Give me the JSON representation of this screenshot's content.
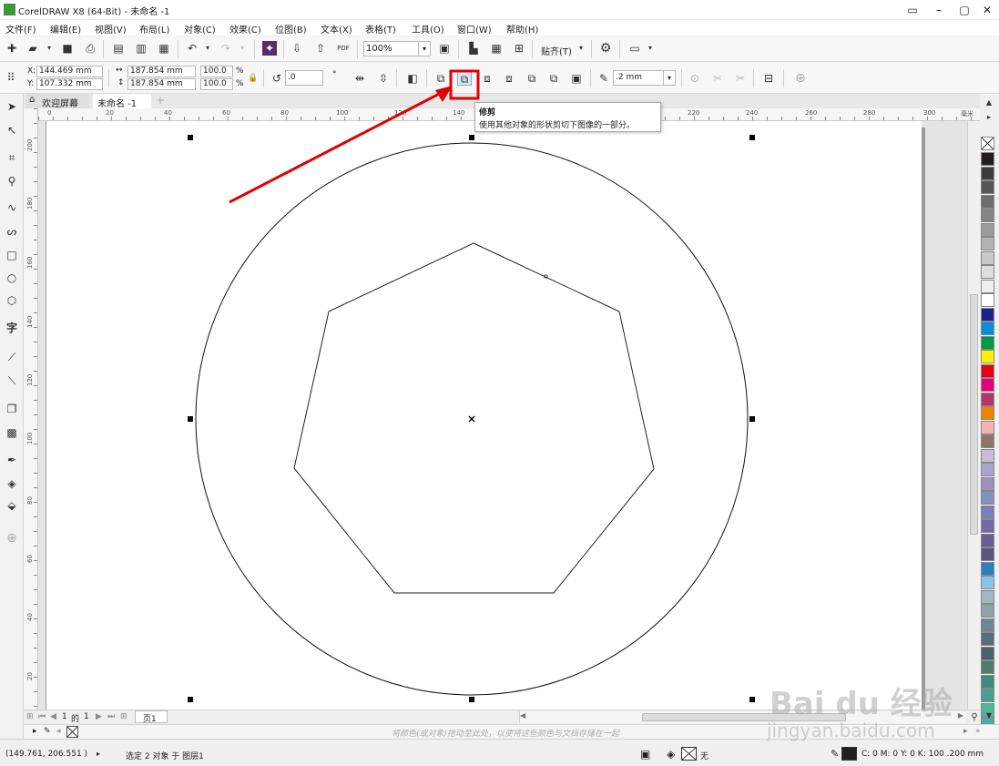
{
  "app": {
    "title": "CorelDRAW X8 (64-Bit) - 未命名 -1",
    "window_buttons": [
      "▭",
      "–",
      "▢",
      "✕"
    ]
  },
  "menu": [
    "文件(F)",
    "编辑(E)",
    "视图(V)",
    "布局(L)",
    "对象(C)",
    "效果(C)",
    "位图(B)",
    "文本(X)",
    "表格(T)",
    "工具(O)",
    "窗口(W)",
    "帮助(H)"
  ],
  "toolbar": {
    "zoom": "100%",
    "snap_label": "贴齐(T)",
    "pdf": "PDF"
  },
  "propbar": {
    "x_label": "X:",
    "x_value": "144.469 mm",
    "y_label": "Y:",
    "y_value": "107.332 mm",
    "w_value": "187.854 mm",
    "h_value": "187.854 mm",
    "scale_w": "100.0",
    "scale_h": "100.0",
    "pct": "%",
    "rotation": ".0",
    "degree": "°",
    "outline_width": ".2 mm"
  },
  "tabs": {
    "welcome": "欢迎屏幕",
    "doc": "未命名 -1"
  },
  "ruler": {
    "unit": "毫米",
    "top_ticks": [
      "0",
      "20",
      "40",
      "60",
      "80",
      "100",
      "120",
      "140",
      "220",
      "240",
      "260",
      "280",
      "300"
    ],
    "left_ticks": [
      "200",
      "180",
      "160",
      "140",
      "120",
      "100",
      "80",
      "60",
      "40",
      "20"
    ]
  },
  "tooltip": {
    "title": "修剪",
    "desc": "使用其他对象的形状剪切下图像的一部分。"
  },
  "pagenav": {
    "current": "1",
    "of": "的",
    "total": "1",
    "page_tab": "页1"
  },
  "docpalette_hint": "将颜色(或对象)拖动至此处，以便将这些颜色与文档存储在一起",
  "status": {
    "coords": "(149.761, 206.551 )",
    "selection": "选定 2 对象 于 图层1",
    "fill_none": "无",
    "outline": "C: 0 M: 0 Y: 0 K: 100  .200 mm"
  },
  "watermark": {
    "brand": "Bai du 经验",
    "url": "jingyan.baidu.com"
  },
  "colors": {
    "highlight": "#e00000",
    "palette": [
      "#231f20",
      "#3d3d3d",
      "#565656",
      "#6d6d6d",
      "#858585",
      "#9c9c9c",
      "#b3b3b3",
      "#c9c9c9",
      "#dedede",
      "#efefef",
      "#ffffff",
      "#1d2088",
      "#0091d9",
      "#009944",
      "#fff100",
      "#e60012",
      "#e4007f",
      "#b3356c",
      "#f08300",
      "#f5b2b2",
      "#8f7565",
      "#c9bcd9",
      "#a9a3cf",
      "#9d8fbf",
      "#8491c3",
      "#7b7fb8",
      "#7468a8",
      "#675c93",
      "#5b557e",
      "#2b80c5",
      "#87c4e8",
      "#a1b5c2",
      "#8fa3ad",
      "#6e8792",
      "#56707b",
      "#486269",
      "#4e7d70",
      "#3e8a7d",
      "#4aa08f",
      "#51b59a",
      "#50a7a6",
      "#3c9dad"
    ]
  }
}
